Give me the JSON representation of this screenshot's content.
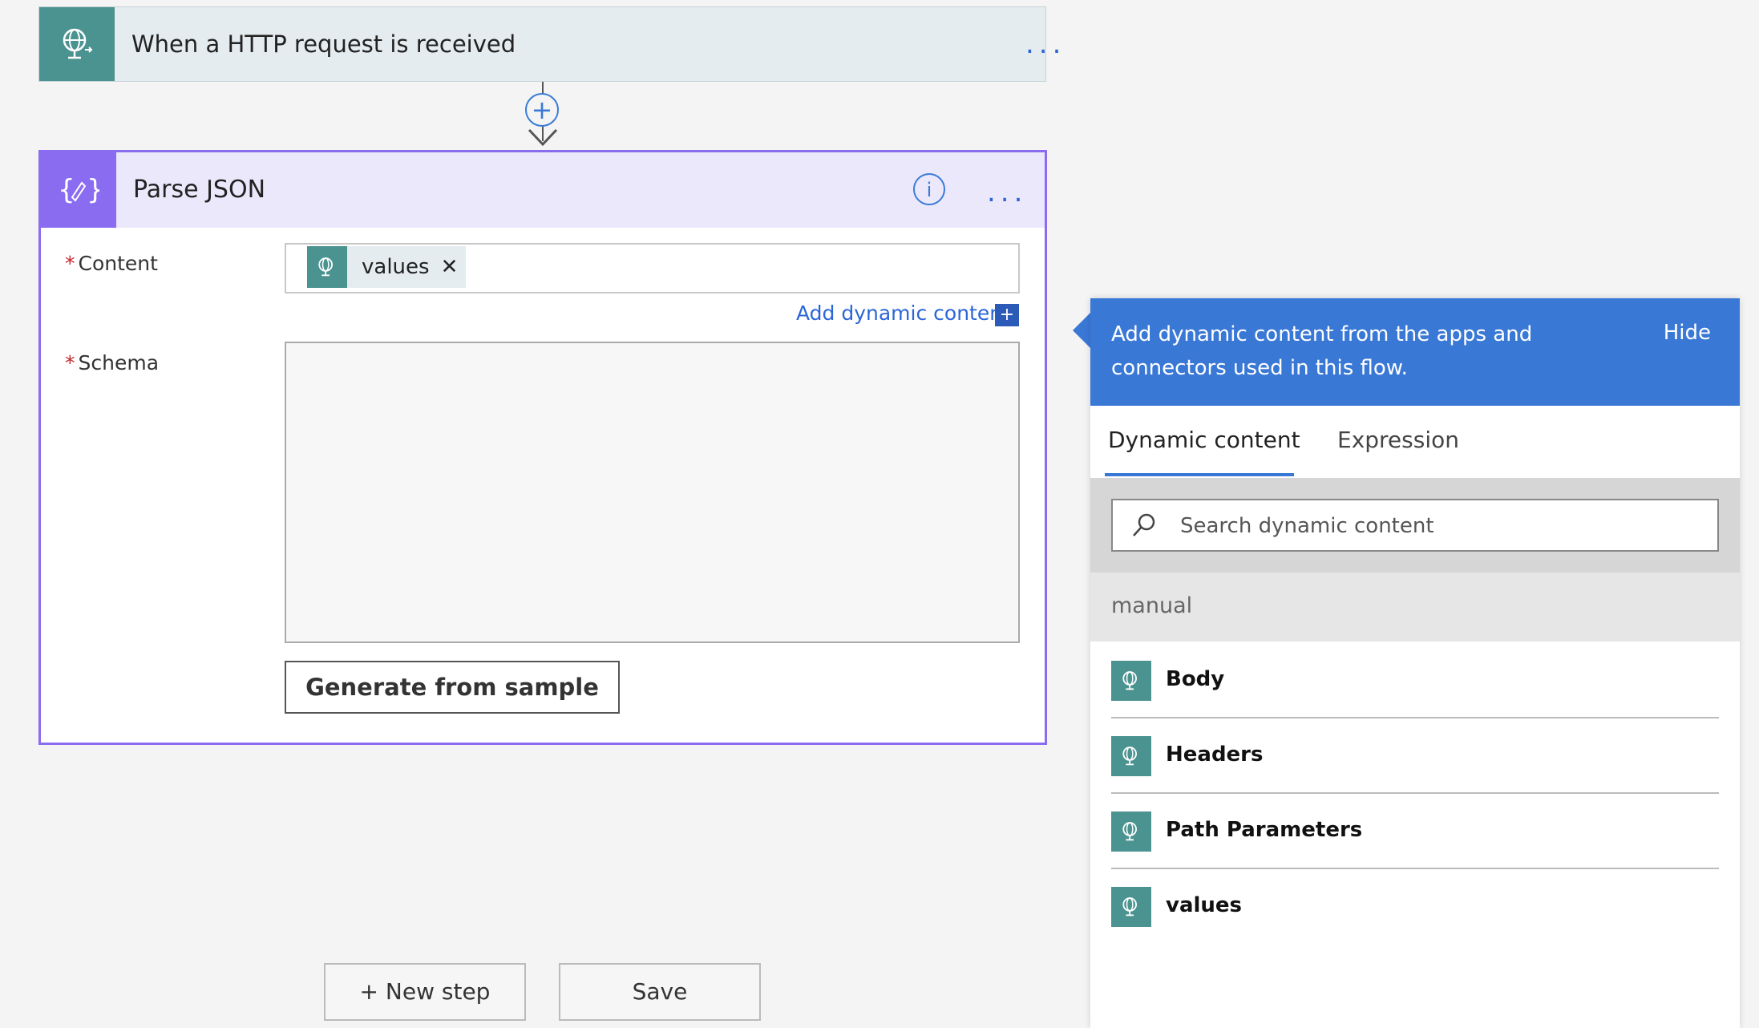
{
  "trigger": {
    "title": "When a HTTP request is received",
    "icon": "globe-request-icon",
    "more": "..."
  },
  "connector": {
    "add": "+"
  },
  "parse_json": {
    "title": "Parse JSON",
    "info": "i",
    "more": "...",
    "required_mark": "*",
    "content_label": "Content",
    "content_token": "values",
    "token_close": "✕",
    "add_dynamic_label": "Add dynamic content",
    "add_dynamic_plus": "+",
    "schema_label": "Schema",
    "generate_button": "Generate from sample"
  },
  "bottom": {
    "new_step": "+ New step",
    "save": "Save"
  },
  "dynamic_panel": {
    "message": "Add dynamic content from the apps and connectors used in this flow.",
    "hide": "Hide",
    "tabs": [
      "Dynamic content",
      "Expression"
    ],
    "search_placeholder": "Search dynamic content",
    "group": "manual",
    "items": [
      "Body",
      "Headers",
      "Path Parameters",
      "values"
    ]
  },
  "colors": {
    "trigger_accent": "#4b9390",
    "parse_accent": "#8a6cf0",
    "panel_header": "#3a78d6",
    "link": "#2b66d6"
  }
}
